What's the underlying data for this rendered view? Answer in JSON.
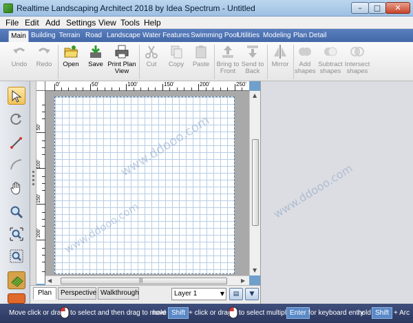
{
  "window": {
    "title": "Realtime Landscaping Architect 2018 by Idea Spectrum - Untitled",
    "min_glyph": "–",
    "max_glyph": "□",
    "close_glyph": "✕"
  },
  "menu": [
    "File",
    "Edit",
    "Add",
    "Settings",
    "View",
    "Tools",
    "Help"
  ],
  "tabs": [
    "Main",
    "Building",
    "Terrain",
    "Road",
    "Landscape",
    "Water Features",
    "Swimming Pool",
    "Utilities",
    "Modeling",
    "Plan Detail"
  ],
  "active_tab": "Main",
  "toolbar": {
    "undo": "Undo",
    "redo": "Redo",
    "open": "Open",
    "save": "Save",
    "print_plan_view": "Print Plan View",
    "cut": "Cut",
    "copy": "Copy",
    "paste": "Paste",
    "bring_to_front": "Bring to Front",
    "send_to_back": "Send to Back",
    "mirror": "Mirror",
    "add_shapes": "Add shapes",
    "subtract_shapes": "Subtract shapes",
    "intersect_shapes": "Intersect shapes"
  },
  "tools": [
    {
      "icon": "select-arrow-icon",
      "selected": true
    },
    {
      "icon": "rotate-icon"
    },
    {
      "icon": "measure-line-icon"
    },
    {
      "icon": "arc-icon"
    },
    {
      "icon": "pan-hand-icon"
    },
    {
      "icon": "zoom-in-icon"
    },
    {
      "icon": "zoom-extents-icon"
    },
    {
      "icon": "zoom-window-icon"
    },
    {
      "icon": "grid-terrain-icon"
    }
  ],
  "ruler": {
    "horizontal": [
      "0'",
      "50'",
      "100'",
      "150'",
      "200'",
      "250'"
    ],
    "vertical": [
      "50'",
      "100'",
      "150'",
      "200'"
    ]
  },
  "view_tabs": [
    "Plan",
    "Perspective",
    "Walkthrough"
  ],
  "active_view": "Plan",
  "layer_select": "Layer 1",
  "watermark": "www.ddooo.com",
  "colors": {
    "ribbon_tabs": "#4a70b0",
    "status_bar": "#34416b",
    "grid_line": "#b7cde4",
    "key_badge": "#5a89c7"
  },
  "statusbar": {
    "move": "Move",
    "click_or_drag_1": "click or drag",
    "to_select_then_move": "to select and then drag to move",
    "hold_1": "hold",
    "shift_1": "Shift",
    "plus_click_or_drag": "+ click or drag",
    "to_select_multiple": "to select multiple",
    "enter": "Enter",
    "for_keyboard_entry": "for keyboard entry",
    "hold_2": "hold",
    "shift_2": "Shift",
    "plus_arc": "+ Arc"
  }
}
